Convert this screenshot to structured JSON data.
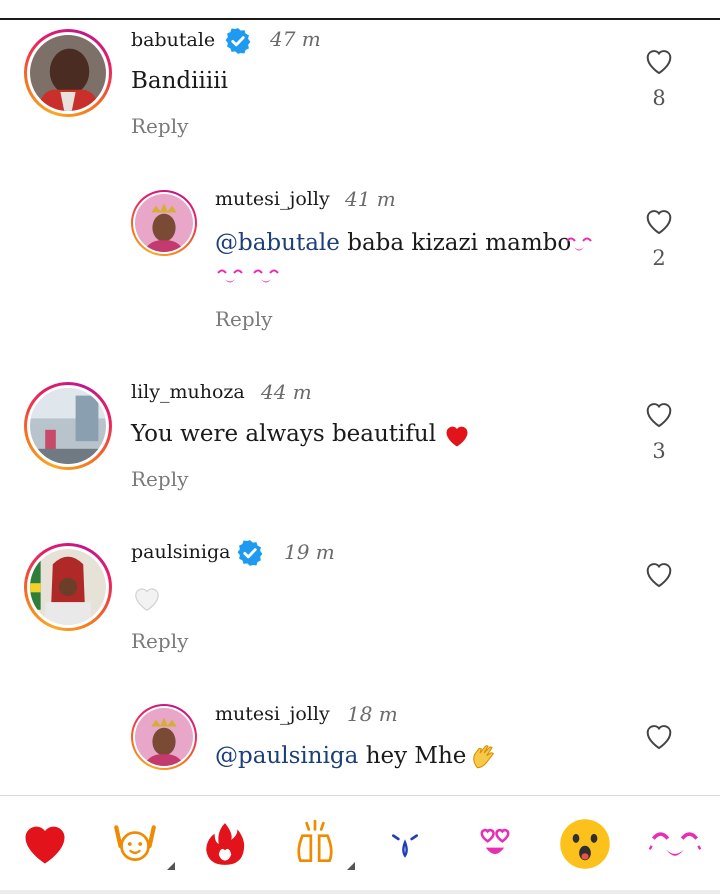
{
  "comments": [
    {
      "username": "babutale",
      "verified": true,
      "time": "47 m",
      "text": "Bandiiiii",
      "reply_label": "Reply",
      "like_count": "8"
    },
    {
      "username": "mutesi_jolly",
      "verified": false,
      "time": "41 m",
      "mention": "@babutale",
      "text": "baba kizazi mambo",
      "reply_label": "Reply",
      "like_count": "2"
    },
    {
      "username": "lily_muhoza",
      "verified": false,
      "time": "44 m",
      "text": "You were always beautiful",
      "reply_label": "Reply",
      "like_count": "3"
    },
    {
      "username": "paulsiniga",
      "verified": true,
      "time": "19 m",
      "text": "",
      "reply_label": "Reply",
      "like_count": ""
    },
    {
      "username": "mutesi_jolly",
      "verified": false,
      "time": "18 m",
      "mention": "@paulsiniga",
      "text": "hey Mhe",
      "reply_label": "",
      "like_count": ""
    }
  ],
  "emoji_bar": [
    "red-heart",
    "raising-hands",
    "fire",
    "clapping-hands",
    "crying-face",
    "heart-eyes-face",
    "surprised-face",
    "kissing-closed-eyes-face"
  ],
  "colors": {
    "accent_heart": "#e3131b",
    "mention": "#1c3f7a",
    "verified": "#1d9bf0",
    "emoji_pink": "#e72fb4"
  }
}
